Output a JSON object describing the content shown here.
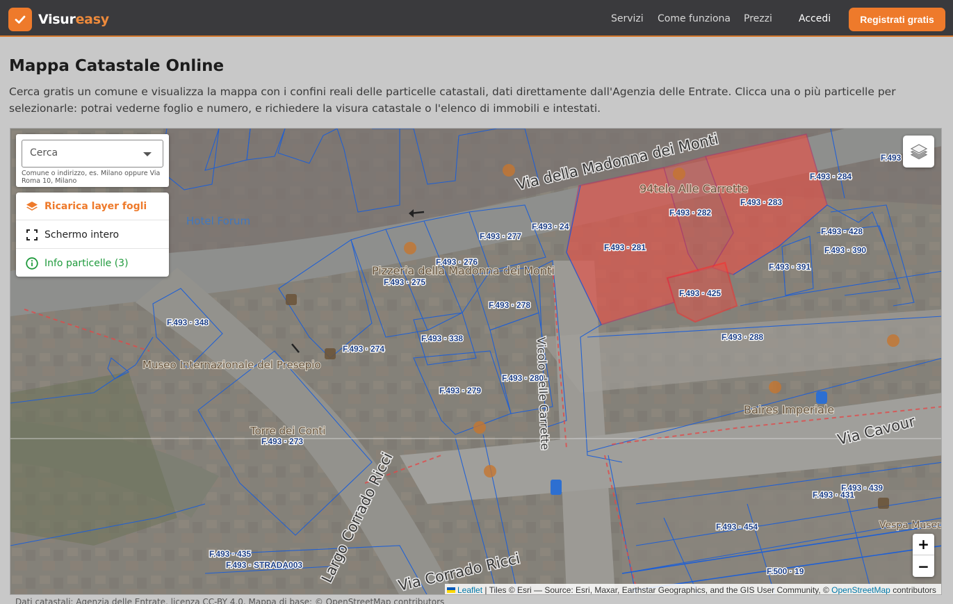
{
  "header": {
    "brand_part1": "Visur",
    "brand_part2": "easy",
    "nav": [
      "Servizi",
      "Come funziona",
      "Prezzi"
    ],
    "login": "Accedi",
    "register": "Registrati gratis",
    "colors": {
      "bar": "#3a3a3d",
      "accent": "#ee7a2b"
    }
  },
  "page": {
    "title": "Mappa Catastale Online",
    "description": "Cerca gratis un comune e visualizza la mappa con i confini reali delle particelle catastali, dati direttamente dall'Agenzia delle Entrate. Clicca una o più particelle per selezionarle: potrai vederne foglio e numero, e richiedere la visura catastale o l'elenco di immobili e intestati."
  },
  "search": {
    "placeholder": "Cerca",
    "hint": "Comune o indirizzo, es. Milano oppure Via Roma 10, Milano"
  },
  "panel": {
    "reload": "Ricarica layer fogli",
    "fullscreen": "Schermo intero",
    "info": "Info particelle (3)"
  },
  "map": {
    "streets": [
      "Via della Madonna dei Monti",
      "Via Cavour",
      "Largo Corrado Ricci",
      "Via Corrado Ricci",
      "Vicolo delle Carrette"
    ],
    "pois": [
      "Hotel Forum",
      "Pizzeria della Madonna dei Monti",
      "Museo Internazionale del Presepio",
      "Torre dei Conti",
      "94tele Alle Carrette",
      "Baires Imperiale",
      "Vespa Museum"
    ],
    "parcels": [
      "F.493 · 284",
      "F.493 · 283",
      "F.493 · 282",
      "F.493 · 281",
      "F.493 · 425",
      "F.493 · 428",
      "F.493 · 390",
      "F.493 · 391",
      "F.493 · 288",
      "F.493 · 24",
      "F.493 · 277",
      "F.493 · 276",
      "F.493 · 275",
      "F.493 · 278",
      "F.493 · 348",
      "F.493 · 338",
      "F.493 · 274",
      "F.493 · 280",
      "F.493 · 279",
      "F.493 · 273",
      "F.493 · 439",
      "F.493 · 431",
      "F.493 · 454",
      "F.493 · 435",
      "F.493 · STRADA003",
      "F.500 · 19",
      "F.493"
    ],
    "selected_parcels": [
      "F.493 · 281",
      "F.493 · 282",
      "F.493 · 283",
      "F.493 · 425"
    ],
    "colors": {
      "parcel_line": "#1d5fd6",
      "selected_fill": "#e2544a",
      "selected_line": "#ff3030"
    }
  },
  "zoom": {
    "in": "+",
    "out": "−"
  },
  "attribution": {
    "leaflet": "Leaflet",
    "text": "| Tiles © Esri — Source: Esri, Maxar, Earthstar Geographics, and the GIS User Community, ©",
    "osm": "OpenStreetMap",
    "suffix": "contributors"
  },
  "footer_note": "Dati catastali: Agenzia delle Entrate, licenza CC-BY 4.0. Mappa di base: © OpenStreetMap contributors"
}
